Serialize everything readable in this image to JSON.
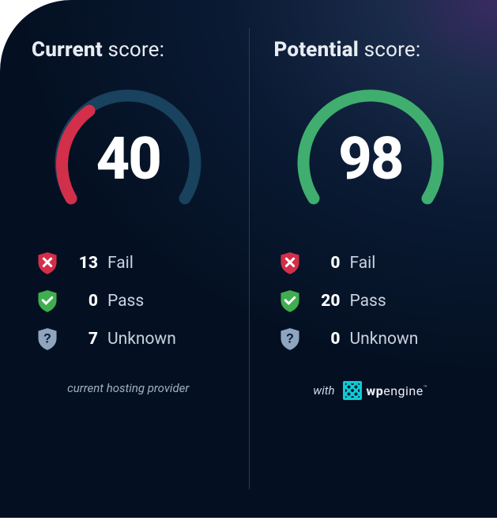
{
  "current": {
    "title_bold": "Current",
    "title_rest": " score:",
    "score": "40",
    "fail": {
      "count": "13",
      "label": "Fail"
    },
    "pass": {
      "count": "0",
      "label": "Pass"
    },
    "unknown": {
      "count": "7",
      "label": "Unknown"
    },
    "footer": "current hosting provider"
  },
  "potential": {
    "title_bold": "Potential",
    "title_rest": " score:",
    "score": "98",
    "fail": {
      "count": "0",
      "label": "Fail"
    },
    "pass": {
      "count": "20",
      "label": "Pass"
    },
    "unknown": {
      "count": "0",
      "label": "Unknown"
    },
    "footer_prefix": "with",
    "brand_bold": "wp",
    "brand_rest": "engine"
  },
  "colors": {
    "fail": "#d32f4a",
    "pass": "#3fae4f",
    "unknown": "#8fa4bf",
    "gauge_track": "#18425d",
    "gauge_green": "#3fae6f"
  },
  "chart_data": [
    {
      "type": "pie",
      "subtype": "gauge",
      "title": "Current score",
      "values": [
        40
      ],
      "range": [
        0,
        100
      ],
      "series": [
        {
          "name": "score",
          "values": [
            40
          ]
        }
      ],
      "breakdown": {
        "Fail": 13,
        "Pass": 0,
        "Unknown": 7
      },
      "note": "current hosting provider"
    },
    {
      "type": "pie",
      "subtype": "gauge",
      "title": "Potential score",
      "values": [
        98
      ],
      "range": [
        0,
        100
      ],
      "series": [
        {
          "name": "score",
          "values": [
            98
          ]
        }
      ],
      "breakdown": {
        "Fail": 0,
        "Pass": 20,
        "Unknown": 0
      },
      "note": "with WP Engine"
    }
  ]
}
